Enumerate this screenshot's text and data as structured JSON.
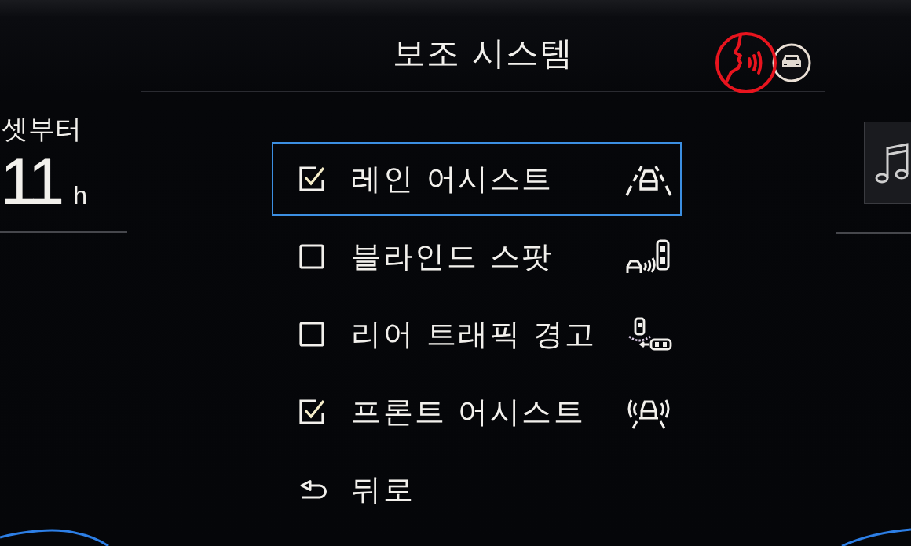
{
  "title": "보조 시스템",
  "left_panel": {
    "label": "셋부터",
    "value": "11",
    "unit": "h"
  },
  "options": [
    {
      "label": "레인 어시스트",
      "checked": true,
      "selected": true
    },
    {
      "label": "블라인드 스팟",
      "checked": false,
      "selected": false
    },
    {
      "label": "리어 트래픽 경고",
      "checked": false,
      "selected": false
    },
    {
      "label": "프론트 어시스트",
      "checked": true,
      "selected": false
    }
  ],
  "back_item": {
    "label": "뒤로",
    "selected": false
  }
}
